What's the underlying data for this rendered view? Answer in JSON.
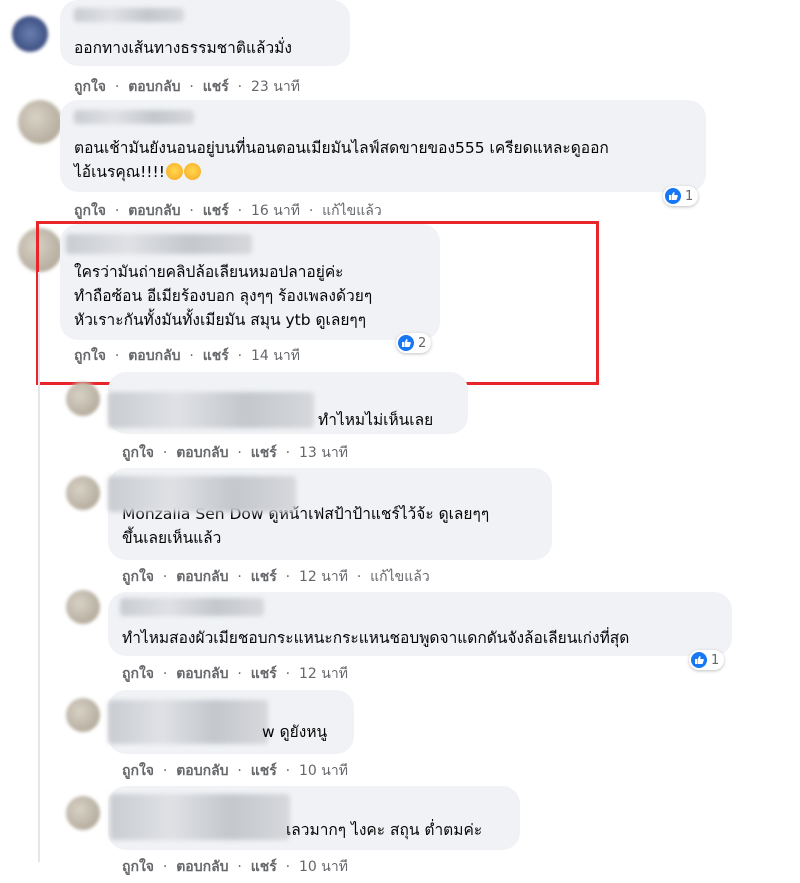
{
  "comments": [
    {
      "text_lines": [
        "ออกทางเส้นทางธรรมชาติแล้วมั่ง"
      ],
      "like": "ถูกใจ",
      "reply": "ตอบกลับ",
      "share": "แชร์",
      "time": "23 นาที",
      "edited": ""
    },
    {
      "text_lines": [
        "ตอนเช้ามันยังนอนอยู่บนที่นอนตอนเมียมันไลฟ์สดขายของ555 เครียดแหละดูออก",
        "ไอ้เนรคุณ!!!!"
      ],
      "like": "ถูกใจ",
      "reply": "ตอบกลับ",
      "share": "แชร์",
      "time": "16 นาที",
      "edited": "แก้ไขแล้ว",
      "reaction_count": "1"
    },
    {
      "text_lines": [
        "ใครว่ามันถ่ายคลิปล้อเลียนหมอปลาอยู่ค่ะ",
        "ทำถือซ้อน อีเมียร้องบอก ลุงๆๆ ร้องเพลงด้วยๆ",
        "หัวเราะกันทั้งมันทั้งเมียมัน สมุน ytb ดูเลยๆๆ"
      ],
      "like": "ถูกใจ",
      "reply": "ตอบกลับ",
      "share": "แชร์",
      "time": "14 นาที",
      "reaction_count": "2"
    },
    {
      "text_lines": [
        "ทำไหมไม่เห็นเลย"
      ],
      "like": "ถูกใจ",
      "reply": "ตอบกลับ",
      "share": "แชร์",
      "time": "13 นาที"
    },
    {
      "text_lines": [
        "Monzalia Sen Dow ดูหน้าเฟสป้าป้าแชร์ไว้จ้ะ ดูเลยๆๆ",
        "ขึ้นเลยเห็นแล้ว"
      ],
      "like": "ถูกใจ",
      "reply": "ตอบกลับ",
      "share": "แชร์",
      "time": "12 นาที",
      "edited": "แก้ไขแล้ว"
    },
    {
      "text_lines": [
        "ทำไหมสองผัวเมียชอบกระแหนะกระแหนชอบพูดจาแดกดันจังล้อเลียนเก่งที่สุด"
      ],
      "like": "ถูกใจ",
      "reply": "ตอบกลับ",
      "share": "แชร์",
      "time": "12 นาที",
      "reaction_count": "1"
    },
    {
      "text_lines": [
        "w ดูยังหนู"
      ],
      "like": "ถูกใจ",
      "reply": "ตอบกลับ",
      "share": "แชร์",
      "time": "10 นาที"
    },
    {
      "text_lines": [
        "เลวมากๆ ไงคะ สถุน ต่ำตมค่ะ"
      ],
      "like": "ถูกใจ",
      "reply": "ตอบกลับ",
      "share": "แชร์",
      "time": "10 นาที"
    }
  ],
  "separator": "·",
  "colors": {
    "highlight": "#e8262a",
    "like_blue": "#1877f2",
    "bubble": "#f0f2f5",
    "meta": "#65676b"
  }
}
